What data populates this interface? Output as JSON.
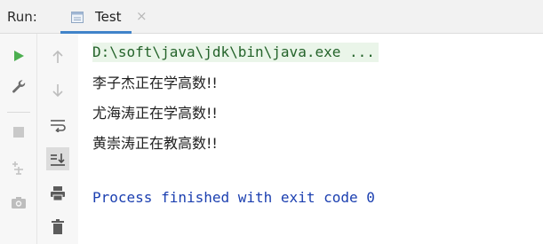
{
  "header": {
    "run_label": "Run:",
    "tab_label": "Test",
    "tab_close": "×"
  },
  "toolbar": {
    "left": [
      "play-icon",
      "wrench-icon",
      "stop-icon",
      "pin-icon",
      "camera-icon"
    ],
    "right": [
      "arrow-up-icon",
      "arrow-down-icon",
      "soft-wrap-icon",
      "scroll-to-end-icon",
      "print-icon",
      "trash-icon"
    ]
  },
  "console": {
    "command": "D:\\soft\\java\\jdk\\bin\\java.exe ...",
    "output_lines": [
      "李子杰正在学高数!!",
      "尤海涛正在学高数!!",
      "黄崇涛正在教高数!!"
    ],
    "process_text": "Process finished with exit code 0"
  },
  "colors": {
    "play_green": "#4caf50",
    "command_bg": "#eaf5e9",
    "command_text": "#24632a",
    "process_text": "#1b3fb0",
    "tab_underline": "#4083c9"
  }
}
